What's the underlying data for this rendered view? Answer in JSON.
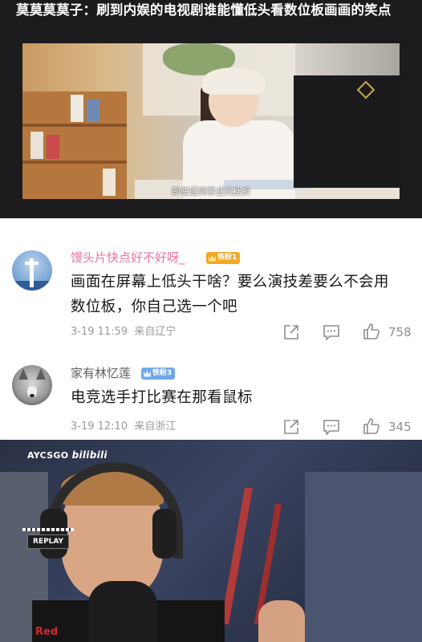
{
  "post": {
    "title": "莫莫莫莫子：刷到内娱的电视剧谁能懂低头看数位板画画的笑点",
    "video_subtitle": "即使遇到事业的挫折"
  },
  "comments": [
    {
      "username": "馒头片快点好不好呀_",
      "badge": "铁粉1",
      "text_lines": [
        "画面在屏幕上低头干啥？要么演技差要么不会用",
        "数位板，你自己选一个吧"
      ],
      "date": "3-19 11:59",
      "location": "来自辽宁",
      "likes": "758",
      "avatar_icon": "tower-avatar"
    },
    {
      "username": "家有林忆莲",
      "badge": "铁粉3",
      "text_lines": [
        "电竞选手打比赛在那看鼠标"
      ],
      "date": "3-19 12:10",
      "location": "来自浙江",
      "likes": "345",
      "avatar_icon": "wolf-avatar"
    }
  ],
  "stream": {
    "watermark": "AYCSGO",
    "watermark_logo": "bilibili",
    "replay": "REPLAY",
    "jersey": "Red"
  },
  "colors": {
    "username_pink": "#f07299",
    "username_dark": "#5d5d5d",
    "badge_orange": "#f5a623",
    "badge_blue": "#6fa8e8",
    "meta_gray": "#9a9a9a"
  },
  "icons": [
    "share-icon",
    "comment-icon",
    "like-icon"
  ]
}
